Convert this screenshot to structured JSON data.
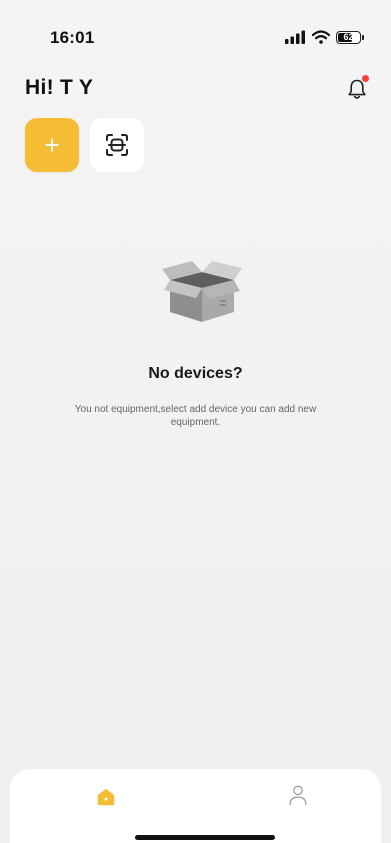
{
  "status_bar": {
    "time": "16:01",
    "battery_level": "62",
    "battery_fraction": 0.62
  },
  "header": {
    "greeting": "Hi! T Y",
    "icons": {
      "notification": "bell-icon"
    }
  },
  "actions": {
    "add_icon": "plus-icon",
    "scan_icon": "scan-icon"
  },
  "empty_state": {
    "icon": "empty-box-icon",
    "title": "No devices?",
    "description": "You not equipment,select add device you can add new equipment."
  },
  "tab_bar": {
    "tabs": [
      {
        "icon": "home-icon",
        "active": true
      },
      {
        "icon": "profile-icon",
        "active": false
      }
    ]
  },
  "colors": {
    "accent": "#f4bd35",
    "background": "#f2f2f2",
    "badge": "#ff3b3b"
  }
}
